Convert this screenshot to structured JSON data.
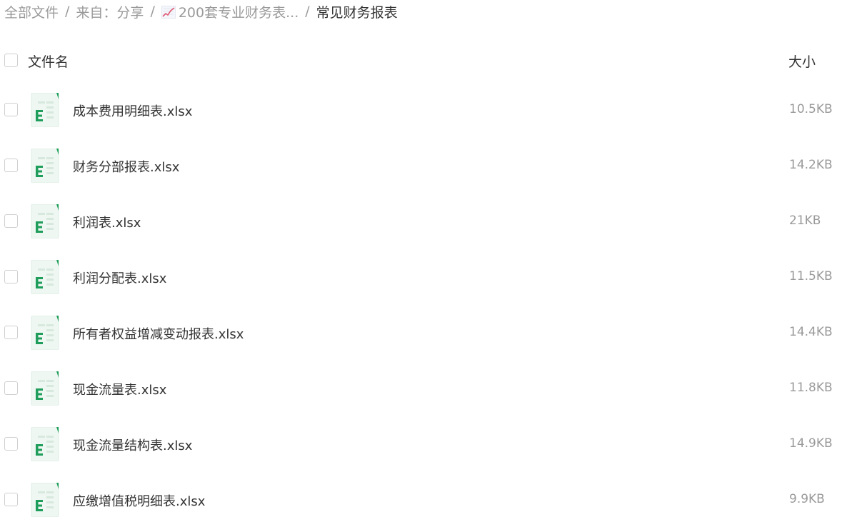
{
  "breadcrumb": {
    "items": [
      "全部文件",
      "来自：分享",
      "200套专业财务表...",
      "常见财务报表"
    ],
    "separator": "/"
  },
  "list_header": {
    "name_label": "文件名",
    "size_label": "大小"
  },
  "files": [
    {
      "name": "成本费用明细表.xlsx",
      "size": "10.5KB",
      "icon": "excel-file-icon"
    },
    {
      "name": "财务分部报表.xlsx",
      "size": "14.2KB",
      "icon": "excel-file-icon"
    },
    {
      "name": "利润表.xlsx",
      "size": "21KB",
      "icon": "excel-file-icon"
    },
    {
      "name": "利润分配表.xlsx",
      "size": "11.5KB",
      "icon": "excel-file-icon"
    },
    {
      "name": "所有者权益增减变动报表.xlsx",
      "size": "14.4KB",
      "icon": "excel-file-icon"
    },
    {
      "name": "现金流量表.xlsx",
      "size": "11.8KB",
      "icon": "excel-file-icon"
    },
    {
      "name": "现金流量结构表.xlsx",
      "size": "14.9KB",
      "icon": "excel-file-icon"
    },
    {
      "name": "应缴增值税明细表.xlsx",
      "size": "9.9KB",
      "icon": "excel-file-icon"
    }
  ],
  "colors": {
    "excel_green": "#1f9e5b",
    "muted_text": "#9a9a9a",
    "primary_text": "#333333"
  }
}
